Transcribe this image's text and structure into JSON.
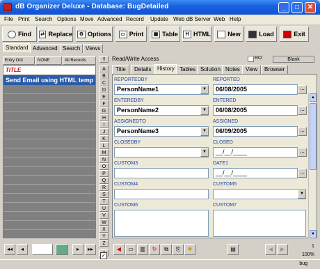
{
  "window": {
    "title": "dB Organizer Deluxe - Database: BugDetailed"
  },
  "menu": [
    "File",
    "Print",
    "Search",
    "Options",
    "Move",
    "Advanced",
    "Record",
    "Update",
    "Web dB Server",
    "Web",
    "Help"
  ],
  "toolbar": {
    "find": "Find",
    "replace": "Replace",
    "options": "Options",
    "print": "Print",
    "table": "Table",
    "html": "HTML",
    "new": "New",
    "load": "Load",
    "exit": "Exit"
  },
  "search_tabs": [
    "Standard",
    "Advanced",
    "Search",
    "Views"
  ],
  "left": {
    "buttons": [
      "Entry Ord",
      "NONE",
      "All Records"
    ],
    "column_header": "TITLE",
    "selected_row": "Send Email using HTML temp"
  },
  "alphabet": [
    "A",
    "B",
    "C",
    "D",
    "E",
    "F",
    "G",
    "H",
    "I",
    "J",
    "K",
    "L",
    "M",
    "N",
    "O",
    "P",
    "Q",
    "R",
    "S",
    "T",
    "U",
    "V",
    "W",
    "X",
    "Y",
    "Z"
  ],
  "access_label": "Read/Write Access",
  "ro_label": "RO",
  "blank_button": "Blank",
  "form_tabs": [
    "Title",
    "Details",
    "History",
    "Tables",
    "Solution",
    "Notes",
    "View",
    "Browser"
  ],
  "active_form_tab": "History",
  "fields": {
    "reportedby": {
      "label": "REPORTEDBY",
      "value": "PersonName1"
    },
    "reported": {
      "label": "REPORTED",
      "value": "06/08/2005"
    },
    "enteredby": {
      "label": "ENTEREDBY",
      "value": "PersonName2"
    },
    "entered": {
      "label": "ENTERED",
      "value": "06/08/2005"
    },
    "assignedto": {
      "label": "ASSIGNEDTO",
      "value": "PersonName3"
    },
    "assigned": {
      "label": "ASSIGNED",
      "value": "06/09/2005"
    },
    "closedby": {
      "label": "CLOSEDBY",
      "value": ""
    },
    "closed": {
      "label": "CLOSED",
      "value": "__/__/____"
    },
    "custom3": {
      "label": "CUSTOM3",
      "value": ""
    },
    "date1": {
      "label": "DATE1",
      "value": "__/__/____"
    },
    "custom4": {
      "label": "CUSTOM4",
      "value": ""
    },
    "custom5": {
      "label": "CUSTOM5",
      "value": ""
    },
    "custom6": {
      "label": "CUSTOM6",
      "value": ""
    },
    "custom7": {
      "label": "CUSTOM7",
      "value": ""
    }
  },
  "record_counter": {
    "current": "1",
    "zoom": "100%"
  },
  "status": {
    "db_name": "bug"
  }
}
